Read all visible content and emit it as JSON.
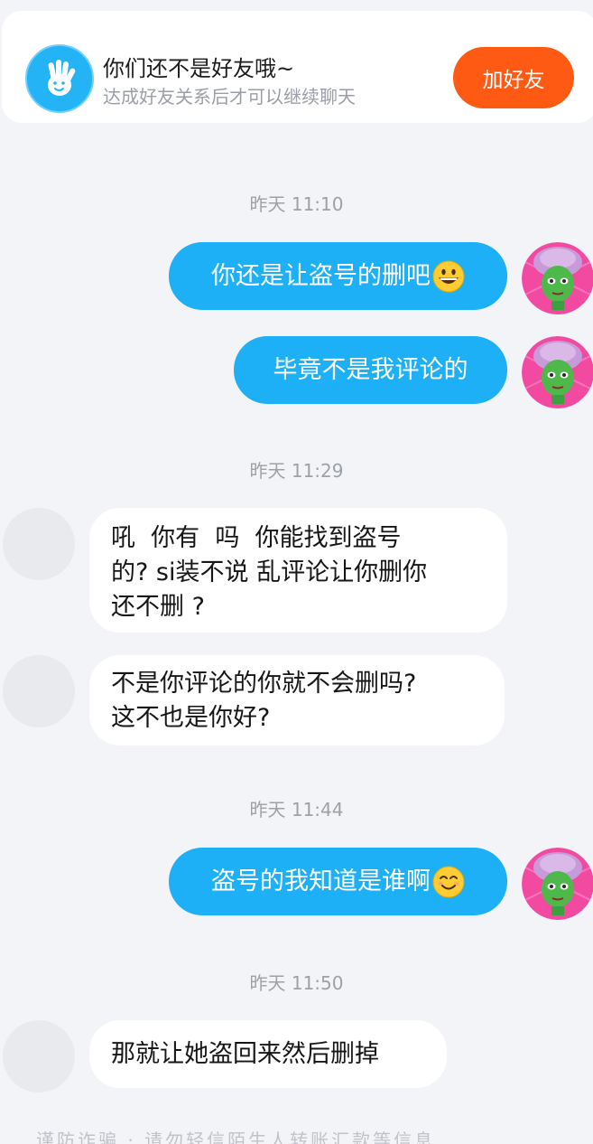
{
  "banner": {
    "title": "你们还不是好友哦~",
    "subtitle": "达成好友关系后才可以继续聊天",
    "add_button": "加好友"
  },
  "messages": [
    {
      "type": "timestamp",
      "text": "昨天 11:10"
    },
    {
      "type": "sent",
      "text": "你还是让盗号的删吧",
      "emoji": "grinning-face-emoji"
    },
    {
      "type": "sent",
      "text": "毕竟不是我评论的"
    },
    {
      "type": "timestamp",
      "text": "昨天 11:29"
    },
    {
      "type": "received",
      "lines": [
        "吼  你有  吗  你能找到盗号",
        "的? si装不说 乱评论让你删你",
        "还不删 ?"
      ]
    },
    {
      "type": "received",
      "lines": [
        "不是你评论的你就不会删吗?",
        "这不也是你好?"
      ]
    },
    {
      "type": "timestamp",
      "text": "昨天 11:44"
    },
    {
      "type": "sent",
      "text": "盗号的我知道是谁啊",
      "emoji": "smiling-face-emoji"
    },
    {
      "type": "timestamp",
      "text": "昨天 11:50"
    },
    {
      "type": "received",
      "lines": [
        "那就让她盗回来然后删掉"
      ]
    }
  ],
  "icons": {
    "banner": "hand-wave-icon",
    "my_avatar": "cartoon-avatar-icon",
    "other_avatar": "placeholder-avatar-icon"
  },
  "colors": {
    "sent_bubble": "#1db0f6",
    "received_bubble": "#ffffff",
    "add_button": "#ff5a13",
    "banner_icon": "#24b3f5",
    "background": "#f3f4f7"
  },
  "footer_hint": "谨防诈骗 · 请勿轻信陌生人转账汇款等信息"
}
